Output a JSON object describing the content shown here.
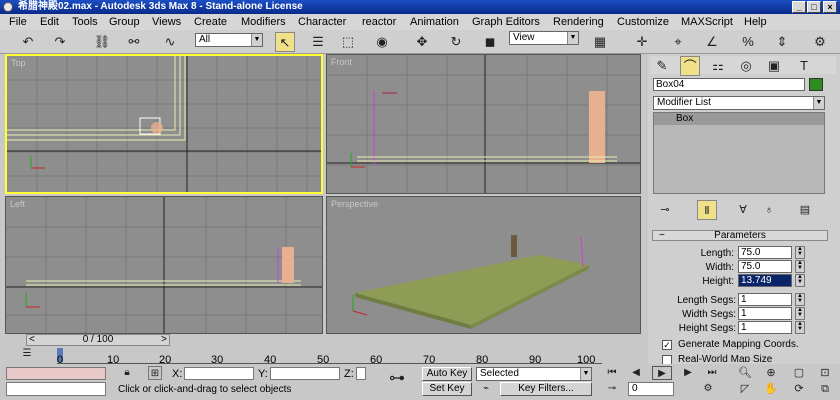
{
  "window": {
    "title": "希腊神殿02.max - Autodesk 3ds Max 8  - Stand-alone License"
  },
  "menu": [
    "File",
    "Edit",
    "Tools",
    "Group",
    "Views",
    "Create",
    "Modifiers",
    "Character",
    "reactor",
    "Animation",
    "Graph Editors",
    "Rendering",
    "Customize",
    "MAXScript",
    "Help"
  ],
  "toolbar": {
    "selection_filter": "All",
    "ref_coord": "View"
  },
  "viewports": {
    "top": "Top",
    "front": "Front",
    "left": "Left",
    "perspective": "Perspective"
  },
  "panel": {
    "object_name": "Box04",
    "object_color": "#2e8b1e",
    "modifier_list": "Modifier List",
    "stack_item": "Box",
    "rollout_title": "Parameters",
    "length_label": "Length:",
    "length_value": "75.0",
    "width_label": "Width:",
    "width_value": "75.0",
    "height_label": "Height:",
    "height_value": "13.749",
    "length_segs_label": "Length Segs:",
    "length_segs_value": "1",
    "width_segs_label": "Width Segs:",
    "width_segs_value": "1",
    "height_segs_label": "Height Segs:",
    "height_segs_value": "1",
    "gen_mapping": "Generate Mapping Coords.",
    "real_world": "Real-World Map Size"
  },
  "timeline": {
    "slider": "0 / 100",
    "ticks": [
      "0",
      "10",
      "20",
      "30",
      "40",
      "50",
      "60",
      "70",
      "80",
      "90",
      "100"
    ]
  },
  "status": {
    "x_label": "X:",
    "y_label": "Y:",
    "z_label": "Z:",
    "prompt": "Click or click-and-drag to select objects",
    "auto_key": "Auto Key",
    "set_key": "Set Key",
    "key_mode": "Selected",
    "key_filters": "Key Filters...",
    "frame": "0"
  }
}
